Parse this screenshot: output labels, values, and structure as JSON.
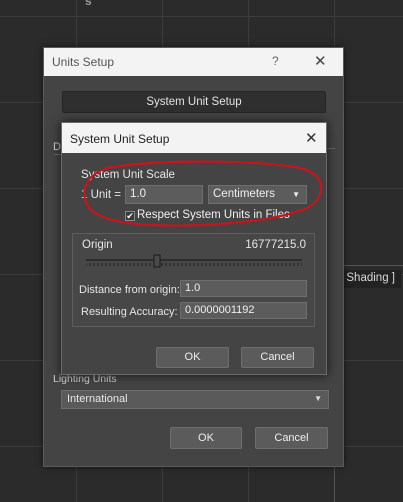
{
  "viewport": {
    "top_fragment": "s",
    "shading_label": "[ Shading ]"
  },
  "units_setup": {
    "title": "Units Setup",
    "help_glyph": "?",
    "close_glyph": "✕",
    "system_unit_setup_button": "System Unit Setup",
    "partial_label_left": "D",
    "lighting_units_label": "Lighting Units",
    "lighting_units_value": "International",
    "ok_label": "OK",
    "cancel_label": "Cancel"
  },
  "system_unit_setup": {
    "title": "System Unit Setup",
    "close_glyph": "✕",
    "scale_group_label": "System Unit Scale",
    "unit_prefix": "1 Unit =",
    "unit_value": "1.0",
    "unit_type": "Centimeters",
    "respect_checked": true,
    "respect_label": "Respect System Units in Files",
    "origin_label": "Origin",
    "origin_value": "16777215.0",
    "distance_label": "Distance from origin:",
    "distance_value": "1.0",
    "accuracy_label": "Resulting Accuracy:",
    "accuracy_value": "0.0000001192",
    "ok_label": "OK",
    "cancel_label": "Cancel"
  },
  "colors": {
    "annotation": "#c8141c",
    "dialog_bg": "#444444",
    "titlebar_bg": "#f3f3f3"
  },
  "icons": {
    "dropdown": "chevron-down-icon",
    "close": "close-icon",
    "help": "help-icon",
    "check": "checkmark-icon"
  }
}
